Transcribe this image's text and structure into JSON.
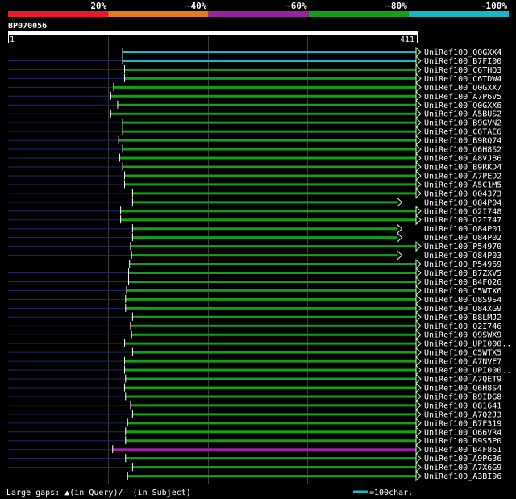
{
  "chart_data": {
    "type": "alignment",
    "query_id": "BP070056",
    "query_start": "1",
    "query_end": "411",
    "query_length": 411,
    "legend_identity": [
      {
        "label": "20%",
        "color": "#e8192c"
      },
      {
        "label": "~40%",
        "color": "#e8791e"
      },
      {
        "label": "~60%",
        "color": "#98249b"
      },
      {
        "label": "~80%",
        "color": "#14a014"
      },
      {
        "label": "~100%",
        "color": "#18b8c8"
      }
    ],
    "footer_note": "Large gaps: ▲(in Query)/– (in Subject)",
    "scale_label": "=100char.",
    "scale_length": 100,
    "hits": [
      {
        "name": "UniRef100_Q0GXX4",
        "start": 115,
        "end": 411,
        "identity": 100,
        "arrow": true
      },
      {
        "name": "UniRef100_B7FI00",
        "start": 115,
        "end": 411,
        "identity": 100,
        "arrow": true
      },
      {
        "name": "UniRef100_C6THQ3",
        "start": 117,
        "end": 411,
        "identity": 80,
        "arrow": true
      },
      {
        "name": "UniRef100_C6TDW4",
        "start": 117,
        "end": 411,
        "identity": 80,
        "arrow": true
      },
      {
        "name": "UniRef100_Q0GXX7",
        "start": 106,
        "end": 411,
        "identity": 80,
        "arrow": true
      },
      {
        "name": "UniRef100_A7P6V5",
        "start": 103,
        "end": 411,
        "identity": 80,
        "arrow": true
      },
      {
        "name": "UniRef100_Q0GXX6",
        "start": 110,
        "end": 411,
        "identity": 80,
        "arrow": true
      },
      {
        "name": "UniRef100_A5BUS2",
        "start": 103,
        "end": 411,
        "identity": 80,
        "arrow": true
      },
      {
        "name": "UniRef100_B9GVN2",
        "start": 115,
        "end": 411,
        "identity": 80,
        "arrow": true
      },
      {
        "name": "UniRef100_C6TAE6",
        "start": 115,
        "end": 411,
        "identity": 80,
        "arrow": true
      },
      {
        "name": "UniRef100_B9RQ74",
        "start": 111,
        "end": 411,
        "identity": 80,
        "arrow": true
      },
      {
        "name": "UniRef100_Q6H8S2",
        "start": 115,
        "end": 411,
        "identity": 80,
        "arrow": true
      },
      {
        "name": "UniRef100_A8VJB6",
        "start": 112,
        "end": 411,
        "identity": 80,
        "arrow": true
      },
      {
        "name": "UniRef100_B9RKD4",
        "start": 115,
        "end": 411,
        "identity": 80,
        "arrow": true
      },
      {
        "name": "UniRef100_A7PED2",
        "start": 117,
        "end": 411,
        "identity": 80,
        "arrow": true
      },
      {
        "name": "UniRef100_A5C1M5",
        "start": 117,
        "end": 411,
        "identity": 80,
        "arrow": true
      },
      {
        "name": "UniRef100_O04373",
        "start": 125,
        "end": 411,
        "identity": 80,
        "arrow": true
      },
      {
        "name": "UniRef100_Q84P04",
        "start": 125,
        "end": 392,
        "identity": 80,
        "arrow": true
      },
      {
        "name": "UniRef100_Q2I748",
        "start": 113,
        "end": 411,
        "identity": 80,
        "arrow": true
      },
      {
        "name": "UniRef100_Q2I747",
        "start": 113,
        "end": 411,
        "identity": 80,
        "arrow": true
      },
      {
        "name": "UniRef100_Q84P01",
        "start": 125,
        "end": 392,
        "identity": 80,
        "arrow": true
      },
      {
        "name": "UniRef100_Q84P02",
        "start": 125,
        "end": 392,
        "identity": 80,
        "arrow": true
      },
      {
        "name": "UniRef100_P54970",
        "start": 123,
        "end": 411,
        "identity": 80,
        "arrow": true
      },
      {
        "name": "UniRef100_Q84P03",
        "start": 124,
        "end": 392,
        "identity": 80,
        "arrow": true
      },
      {
        "name": "UniRef100_P54969",
        "start": 122,
        "end": 411,
        "identity": 80,
        "arrow": true
      },
      {
        "name": "UniRef100_B7ZXV5",
        "start": 121,
        "end": 411,
        "identity": 80,
        "arrow": true
      },
      {
        "name": "UniRef100_B4FQ26",
        "start": 121,
        "end": 411,
        "identity": 80,
        "arrow": true
      },
      {
        "name": "UniRef100_C5WTX6",
        "start": 119,
        "end": 411,
        "identity": 80,
        "arrow": true
      },
      {
        "name": "UniRef100_Q8S9S4",
        "start": 118,
        "end": 411,
        "identity": 80,
        "arrow": true
      },
      {
        "name": "UniRef100_Q84XG9",
        "start": 118,
        "end": 411,
        "identity": 80,
        "arrow": true
      },
      {
        "name": "UniRef100_B8LMJ2",
        "start": 125,
        "end": 411,
        "identity": 80,
        "arrow": true
      },
      {
        "name": "UniRef100_Q2I746",
        "start": 123,
        "end": 411,
        "identity": 80,
        "arrow": true
      },
      {
        "name": "UniRef100_Q9SWX9",
        "start": 124,
        "end": 411,
        "identity": 80,
        "arrow": true
      },
      {
        "name": "UniRef100_UPI000..",
        "start": 117,
        "end": 411,
        "identity": 80,
        "arrow": true
      },
      {
        "name": "UniRef100_C5WTX5",
        "start": 125,
        "end": 411,
        "identity": 80,
        "arrow": true
      },
      {
        "name": "UniRef100_A7NVE7",
        "start": 117,
        "end": 411,
        "identity": 80,
        "arrow": true
      },
      {
        "name": "UniRef100_UPI000..",
        "start": 117,
        "end": 411,
        "identity": 80,
        "arrow": true
      },
      {
        "name": "UniRef100_A7QET9",
        "start": 118,
        "end": 411,
        "identity": 80,
        "arrow": true
      },
      {
        "name": "UniRef100_Q6H8S4",
        "start": 117,
        "end": 411,
        "identity": 80,
        "arrow": true
      },
      {
        "name": "UniRef100_B9IDG8",
        "start": 118,
        "end": 411,
        "identity": 80,
        "arrow": true
      },
      {
        "name": "UniRef100_O81641",
        "start": 123,
        "end": 411,
        "identity": 80,
        "arrow": true
      },
      {
        "name": "UniRef100_A7Q2J3",
        "start": 125,
        "end": 411,
        "identity": 80,
        "arrow": true
      },
      {
        "name": "UniRef100_B7F319",
        "start": 120,
        "end": 411,
        "identity": 80,
        "arrow": true
      },
      {
        "name": "UniRef100_Q66VR4",
        "start": 118,
        "end": 411,
        "identity": 80,
        "arrow": true
      },
      {
        "name": "UniRef100_B9S5P0",
        "start": 118,
        "end": 411,
        "identity": 80,
        "arrow": true
      },
      {
        "name": "UniRef100_B4F861",
        "start": 105,
        "end": 411,
        "identity": 60,
        "arrow": true
      },
      {
        "name": "UniRef100_A9PG36",
        "start": 118,
        "end": 411,
        "identity": 80,
        "arrow": true
      },
      {
        "name": "UniRef100_A7X6G9",
        "start": 125,
        "end": 411,
        "identity": 80,
        "arrow": true
      },
      {
        "name": "UniRef100_A3BI96",
        "start": 120,
        "end": 411,
        "identity": 80,
        "arrow": true
      }
    ]
  }
}
